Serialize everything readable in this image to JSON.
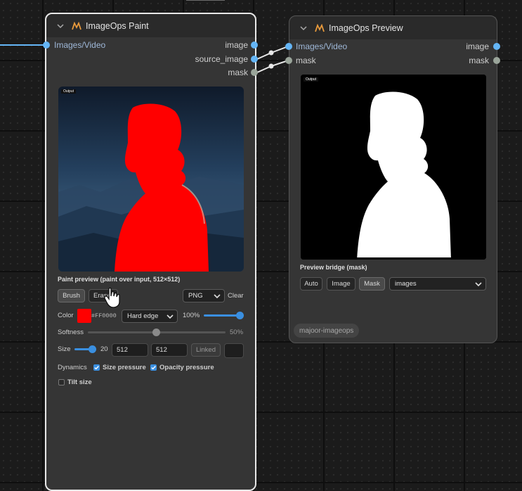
{
  "colors": {
    "accent": "#3a8fe0",
    "paint": "#ff0000",
    "image_port": "#64b5f6",
    "mask_port": "#81c784"
  },
  "paint_node": {
    "title": "ImageOps Paint",
    "icon": "imageops-logo-icon",
    "inputs": [
      "Images/Video"
    ],
    "outputs": [
      "image",
      "source_image",
      "mask"
    ],
    "image_tag": "Output",
    "caption": "Paint preview (paint over input, 512×512)",
    "tools": {
      "brush": "Brush",
      "eraser": "Eraser",
      "format": "PNG",
      "clear": "Clear"
    },
    "color_label": "Color",
    "color_value": "#FF0000",
    "edge_mode": "Hard edge",
    "opacity": {
      "value": 1.0,
      "text": "100%"
    },
    "softness": {
      "label": "Softness",
      "value": 0.5,
      "text": "50%"
    },
    "size": {
      "label": "Size",
      "value": 20,
      "max": 512,
      "text": "20",
      "width": "512",
      "height": "512",
      "linked": "Linked"
    },
    "dynamics": {
      "label": "Dynamics",
      "size_pressure": "Size pressure",
      "size_pressure_checked": true,
      "opacity_pressure": "Opacity pressure",
      "opacity_pressure_checked": true,
      "tilt_size": "Tilt size",
      "tilt_size_checked": false
    }
  },
  "preview_node": {
    "title": "ImageOps Preview",
    "icon": "imageops-logo-icon",
    "inputs": [
      "Images/Video",
      "mask"
    ],
    "outputs": [
      "image",
      "mask"
    ],
    "image_tag": "Output",
    "caption": "Preview bridge (mask)",
    "modes": [
      "Auto",
      "Image",
      "Mask"
    ],
    "active_mode": "Mask",
    "target": "images",
    "badge": "majoor-imageops"
  }
}
